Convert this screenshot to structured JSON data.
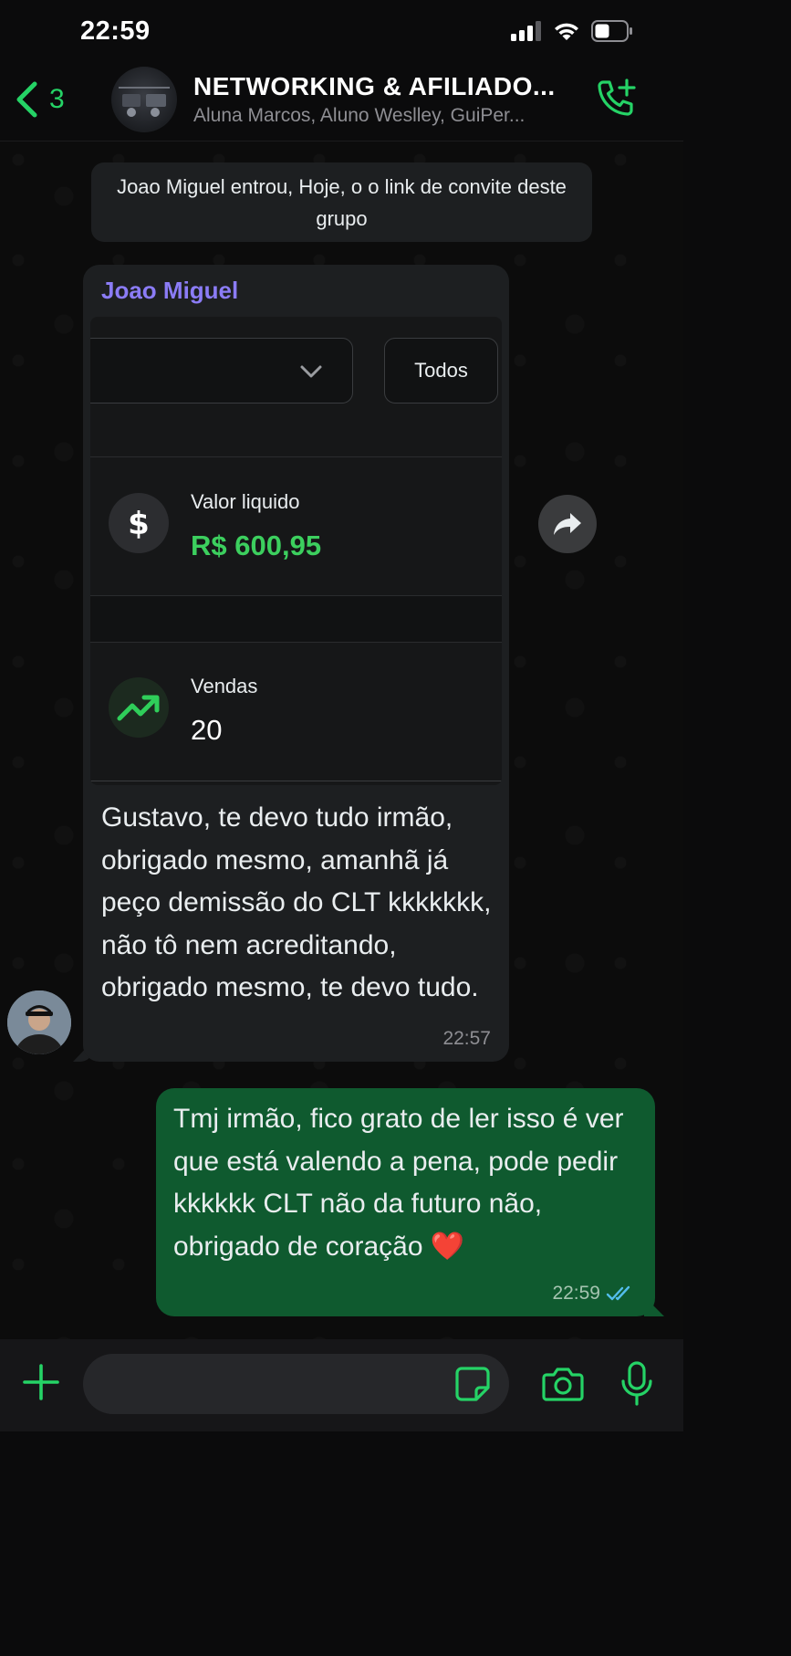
{
  "status_bar": {
    "time": "22:59"
  },
  "header": {
    "back_count": "3",
    "title": "NETWORKING & AFILIADO...",
    "subtitle": "Aluna Marcos, Aluno Weslley, GuiPer..."
  },
  "system_notice": "Joao Miguel entrou, Hoje, o o link de convite deste grupo",
  "incoming": {
    "sender": "Joao Miguel",
    "screenshot": {
      "filter_button": "Todos",
      "metric1_label": "Valor liquido",
      "metric1_value": "R$ 600,95",
      "metric2_label": "Vendas",
      "metric2_value": "20"
    },
    "text": "Gustavo, te devo tudo irmão, obrigado mesmo, amanhã já peço demissão do CLT kkkkkkk, não tô nem acreditando, obrigado mesmo, te devo tudo.",
    "time": "22:57"
  },
  "outgoing": {
    "text": "Tmj irmão, fico grato de ler isso é ver que está valendo a pena, pode pedir kkkkkk CLT não da futuro não, obrigado de coração ❤️",
    "time": "22:59",
    "status": "read"
  },
  "colors": {
    "accent": "#25d366",
    "outgoing_bubble": "#0f5a2f",
    "incoming_bubble": "#1d1f21",
    "sender_name": "#8b7cf6",
    "read_ticks": "#53bdeb"
  },
  "icons": [
    "back-chevron-icon",
    "add-call-icon",
    "forward-icon",
    "dollar-icon",
    "trending-up-icon",
    "plus-icon",
    "sticker-icon",
    "camera-icon",
    "mic-icon"
  ]
}
